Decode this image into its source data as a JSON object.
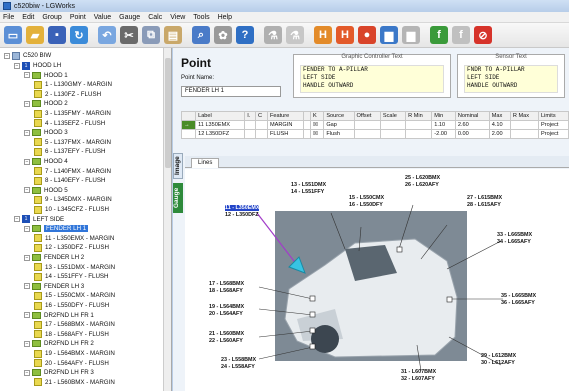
{
  "window": {
    "title": "c520biw - LGWorks"
  },
  "menu": [
    "File",
    "Edit",
    "Group",
    "Point",
    "Value",
    "Gauge",
    "Calc",
    "View",
    "Tools",
    "Help"
  ],
  "toolbar": {
    "buttons": [
      {
        "name": "new-icon",
        "glyph": "▭",
        "color": "#5b8fd6"
      },
      {
        "name": "open-icon",
        "glyph": "▰",
        "color": "#e3b13b"
      },
      {
        "name": "save-icon",
        "glyph": "▪",
        "color": "#3a62b8"
      },
      {
        "name": "refresh-icon",
        "glyph": "↻",
        "color": "#3b8bd9"
      },
      {
        "name": "undo-icon",
        "glyph": "↶",
        "color": "#7aa7e0"
      },
      {
        "name": "cut-icon",
        "glyph": "✂",
        "color": "#6a6a6a"
      },
      {
        "name": "copy-icon",
        "glyph": "⧉",
        "color": "#8a9bb8"
      },
      {
        "name": "paste-icon",
        "glyph": "▤",
        "color": "#c9a86a"
      },
      {
        "name": "find-icon",
        "glyph": "⌕",
        "color": "#4a7bc8"
      },
      {
        "name": "settings-icon",
        "glyph": "✿",
        "color": "#9a9a9a"
      },
      {
        "name": "help-icon",
        "glyph": "?",
        "color": "#2f6fc4"
      },
      {
        "name": "group-a-icon",
        "glyph": "⚗",
        "color": "#b0b0b0"
      },
      {
        "name": "group-b-icon",
        "glyph": "⚗",
        "color": "#c7c7c7"
      },
      {
        "name": "hdg-add-icon",
        "glyph": "H",
        "color": "#e38b2a"
      },
      {
        "name": "hdg-remove-icon",
        "glyph": "H",
        "color": "#e35a2a"
      },
      {
        "name": "record-icon",
        "glyph": "●",
        "color": "#d9442a"
      },
      {
        "name": "chart-icon",
        "glyph": "▆",
        "color": "#3b78c8"
      },
      {
        "name": "chart-gray-icon",
        "glyph": "▆",
        "color": "#b5b5b5"
      },
      {
        "name": "fx-icon",
        "glyph": "f",
        "color": "#3a9a3a"
      },
      {
        "name": "fx-gray-icon",
        "glyph": "f",
        "color": "#c0c0c0"
      },
      {
        "name": "stop-icon",
        "glyph": "⊘",
        "color": "#d6332a"
      }
    ]
  },
  "tree": {
    "root": "C520 BIW",
    "nodes": [
      {
        "level": 1,
        "type": "blue",
        "label": "HOOD LH",
        "badge": "1"
      },
      {
        "level": 2,
        "type": "grp",
        "label": "HOOD 1"
      },
      {
        "level": 3,
        "type": "pt",
        "label": "1 - L130GMY - MARGIN"
      },
      {
        "level": 3,
        "type": "pt",
        "label": "2 - L130FZ - FLUSH"
      },
      {
        "level": 2,
        "type": "grp",
        "label": "HOOD 2"
      },
      {
        "level": 3,
        "type": "pt",
        "label": "3 - L135FMY - MARGIN"
      },
      {
        "level": 3,
        "type": "pt",
        "label": "4 - L135EFZ - FLUSH"
      },
      {
        "level": 2,
        "type": "grp",
        "label": "HOOD 3"
      },
      {
        "level": 3,
        "type": "pt",
        "label": "5 - L137FMX - MARGIN"
      },
      {
        "level": 3,
        "type": "pt",
        "label": "6 - L137EFY - FLUSH"
      },
      {
        "level": 2,
        "type": "grp",
        "label": "HOOD 4"
      },
      {
        "level": 3,
        "type": "pt",
        "label": "7 - L140FMX - MARGIN"
      },
      {
        "level": 3,
        "type": "pt",
        "label": "8 - L140EFY - FLUSH"
      },
      {
        "level": 2,
        "type": "grp",
        "label": "HOOD 5"
      },
      {
        "level": 3,
        "type": "pt",
        "label": "9 - L345DMX - MARGIN"
      },
      {
        "level": 3,
        "type": "pt",
        "label": "10 - L345CFZ - FLUSH"
      },
      {
        "level": 1,
        "type": "blue",
        "label": "LEFT SIDE",
        "badge": "1"
      },
      {
        "level": 2,
        "type": "grp",
        "label": "FENDER LH 1",
        "selected": true
      },
      {
        "level": 3,
        "type": "pt",
        "label": "11 - L350EMX - MARGIN"
      },
      {
        "level": 3,
        "type": "pt",
        "label": "12 - L350DFZ - FLUSH"
      },
      {
        "level": 2,
        "type": "grp",
        "label": "FENDER LH 2"
      },
      {
        "level": 3,
        "type": "pt",
        "label": "13 - L551DMX - MARGIN"
      },
      {
        "level": 3,
        "type": "pt",
        "label": "14 - L551FFY - FLUSH"
      },
      {
        "level": 2,
        "type": "grp",
        "label": "FENDER LH 3"
      },
      {
        "level": 3,
        "type": "pt",
        "label": "15 - L550CMX - MARGIN"
      },
      {
        "level": 3,
        "type": "pt",
        "label": "16 - L550DFY - FLUSH"
      },
      {
        "level": 2,
        "type": "grp",
        "label": "DR2FND LH FR 1"
      },
      {
        "level": 3,
        "type": "pt",
        "label": "17 - L568BMX - MARGIN"
      },
      {
        "level": 3,
        "type": "pt",
        "label": "18 - L568AFY - FLUSH"
      },
      {
        "level": 2,
        "type": "grp",
        "label": "DR2FND LH FR 2"
      },
      {
        "level": 3,
        "type": "pt",
        "label": "19 - L564BMX - MARGIN"
      },
      {
        "level": 3,
        "type": "pt",
        "label": "20 - L564AFY - FLUSH"
      },
      {
        "level": 2,
        "type": "grp",
        "label": "DR2FND LH FR 3"
      },
      {
        "level": 3,
        "type": "pt",
        "label": "21 - L560BMX - MARGIN"
      }
    ]
  },
  "point": {
    "title": "Point",
    "name_label": "Point Name:",
    "name_value": "FENDER LH 1",
    "graphic_title": "Graphic Controller Text",
    "graphic_text": [
      "FENDER TO A-PILLAR",
      "LEFT SIDE",
      "HANDLE OUTWARD"
    ],
    "sensor_title": "Sensor Text",
    "sensor_text": [
      "FNDR TO A-PILLAR",
      "LEFT SIDE",
      "HANDLE OUTWARD"
    ]
  },
  "grid": {
    "columns": [
      "",
      "Label",
      "I.",
      "C",
      "Feature",
      "",
      "K",
      "Source",
      "Offset",
      "Scale",
      "R Min",
      "Min",
      "Nominal",
      "Max",
      "R Max",
      "Limits"
    ],
    "rows": [
      [
        "→",
        "11 L350EMX",
        "",
        "",
        "MARGIN",
        "",
        "☒",
        "Gap",
        "",
        "",
        "",
        "1.10",
        "2.60",
        "4.10",
        "",
        "Project"
      ],
      [
        "",
        "12 L350DFZ",
        "",
        "",
        "FLUSH",
        "",
        "☒",
        "Flush",
        "",
        "",
        "",
        "-2.00",
        "0.00",
        "2.00",
        "",
        "Project"
      ]
    ]
  },
  "tabs": {
    "image": "Image",
    "gauge": "Gauge",
    "lines": "Lines"
  },
  "image_labels": {
    "l11": "11 - L350EMX",
    "l12": "12 - L350DFZ",
    "l13": "13 - L551DMX",
    "l14": "14 - L551FFY",
    "l15": "15 - L550CMX",
    "l16": "16 - L550DFY",
    "l25": "25 - L620BMX",
    "l26": "26 - L620AFY",
    "l27": "27 - L615BMX",
    "l28": "28 - L615AFY",
    "l33": "33 - L665BMX",
    "l34": "34 - L665AFY",
    "l17": "17 - L568BMX",
    "l18": "18 - L568AFY",
    "l19": "19 - L564BMX",
    "l20": "20 - L564AFY",
    "l21": "21 - L560BMX",
    "l22": "22 - L560AFY",
    "l35": "35 - L665BMX",
    "l36": "36 - L665AFY",
    "l23": "23 - L558BMX",
    "l24": "24 - L558AFY",
    "l31": "31 - L607BMX",
    "l32": "32 - L607AFY",
    "l29": "29 - L612BMX",
    "l30": "30 - L612AFY"
  }
}
